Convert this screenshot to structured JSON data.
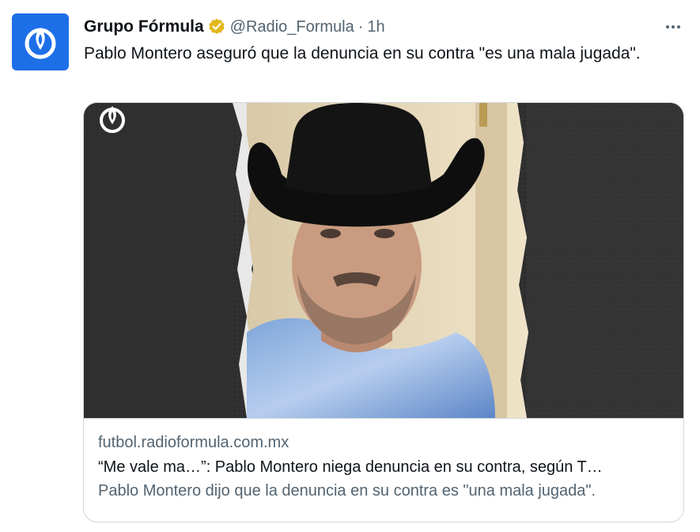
{
  "tweet": {
    "author_name": "Grupo Fórmula",
    "handle": "@Radio_Formula",
    "separator": "·",
    "time": "1h",
    "text": "Pablo Montero aseguró que la denuncia en su contra \"es una mala jugada\"."
  },
  "card": {
    "domain": "futbol.radioformula.com.mx",
    "title": "“Me vale ma…”: Pablo Montero niega denuncia en su contra, según T…",
    "description": "Pablo Montero dijo que la denuncia en su contra es \"una mala jugada\"."
  },
  "icons": {
    "avatar": "grupo-formula-logo-icon",
    "verified": "verified-badge-icon",
    "more": "more-options-icon",
    "watermark": "grupo-formula-watermark-icon"
  },
  "colors": {
    "avatar_bg": "#1d6fe8",
    "verified_gold": "#e2b719",
    "muted_text": "#536471",
    "main_text": "#0f1419",
    "border": "#cfd9de"
  }
}
